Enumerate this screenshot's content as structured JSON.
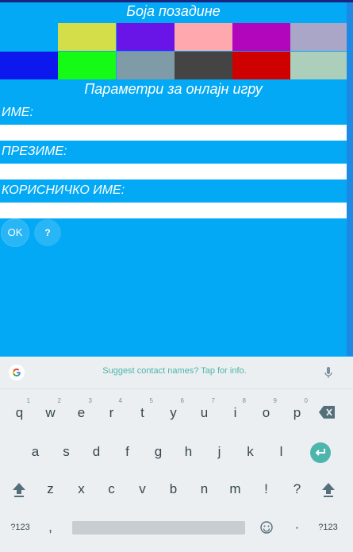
{
  "background_section": {
    "title": "Боја позадине",
    "swatches_row1": [
      "#03a9f4",
      "#d4de48",
      "#6a15e8",
      "#ffa8ae",
      "#b106bc",
      "#a9a6c8"
    ],
    "swatches_row2": [
      "#0d18ee",
      "#16fb16",
      "#7f9ba8",
      "#444444",
      "#cf0000",
      "#abcfbb"
    ]
  },
  "online_section": {
    "title": "Параметри за онлајн игру",
    "fields": [
      {
        "label": "ИМЕ:",
        "value": ""
      },
      {
        "label": "ПРЕЗИМЕ:",
        "value": ""
      },
      {
        "label": "КОРИСНИЧКО ИМЕ:",
        "value": ""
      }
    ],
    "ok_label": "OK",
    "help_label": "?"
  },
  "keyboard": {
    "suggestion": "Suggest contact names? Tap for info.",
    "row1": [
      {
        "k": "q",
        "h": "1"
      },
      {
        "k": "w",
        "h": "2"
      },
      {
        "k": "e",
        "h": "3"
      },
      {
        "k": "r",
        "h": "4"
      },
      {
        "k": "t",
        "h": "5"
      },
      {
        "k": "y",
        "h": "6"
      },
      {
        "k": "u",
        "h": "7"
      },
      {
        "k": "i",
        "h": "8"
      },
      {
        "k": "o",
        "h": "9"
      },
      {
        "k": "p",
        "h": "0"
      }
    ],
    "row2": [
      "a",
      "s",
      "d",
      "f",
      "g",
      "h",
      "j",
      "k",
      "l"
    ],
    "row3": [
      "z",
      "x",
      "c",
      "v",
      "b",
      "n",
      "m",
      "!",
      "?"
    ],
    "bottom": {
      "sym_left": "?123",
      "comma": ",",
      "period": "·",
      "sym_right": "?123"
    },
    "colors": {
      "accent": "#4db6ac",
      "key_text": "#37474f"
    }
  }
}
